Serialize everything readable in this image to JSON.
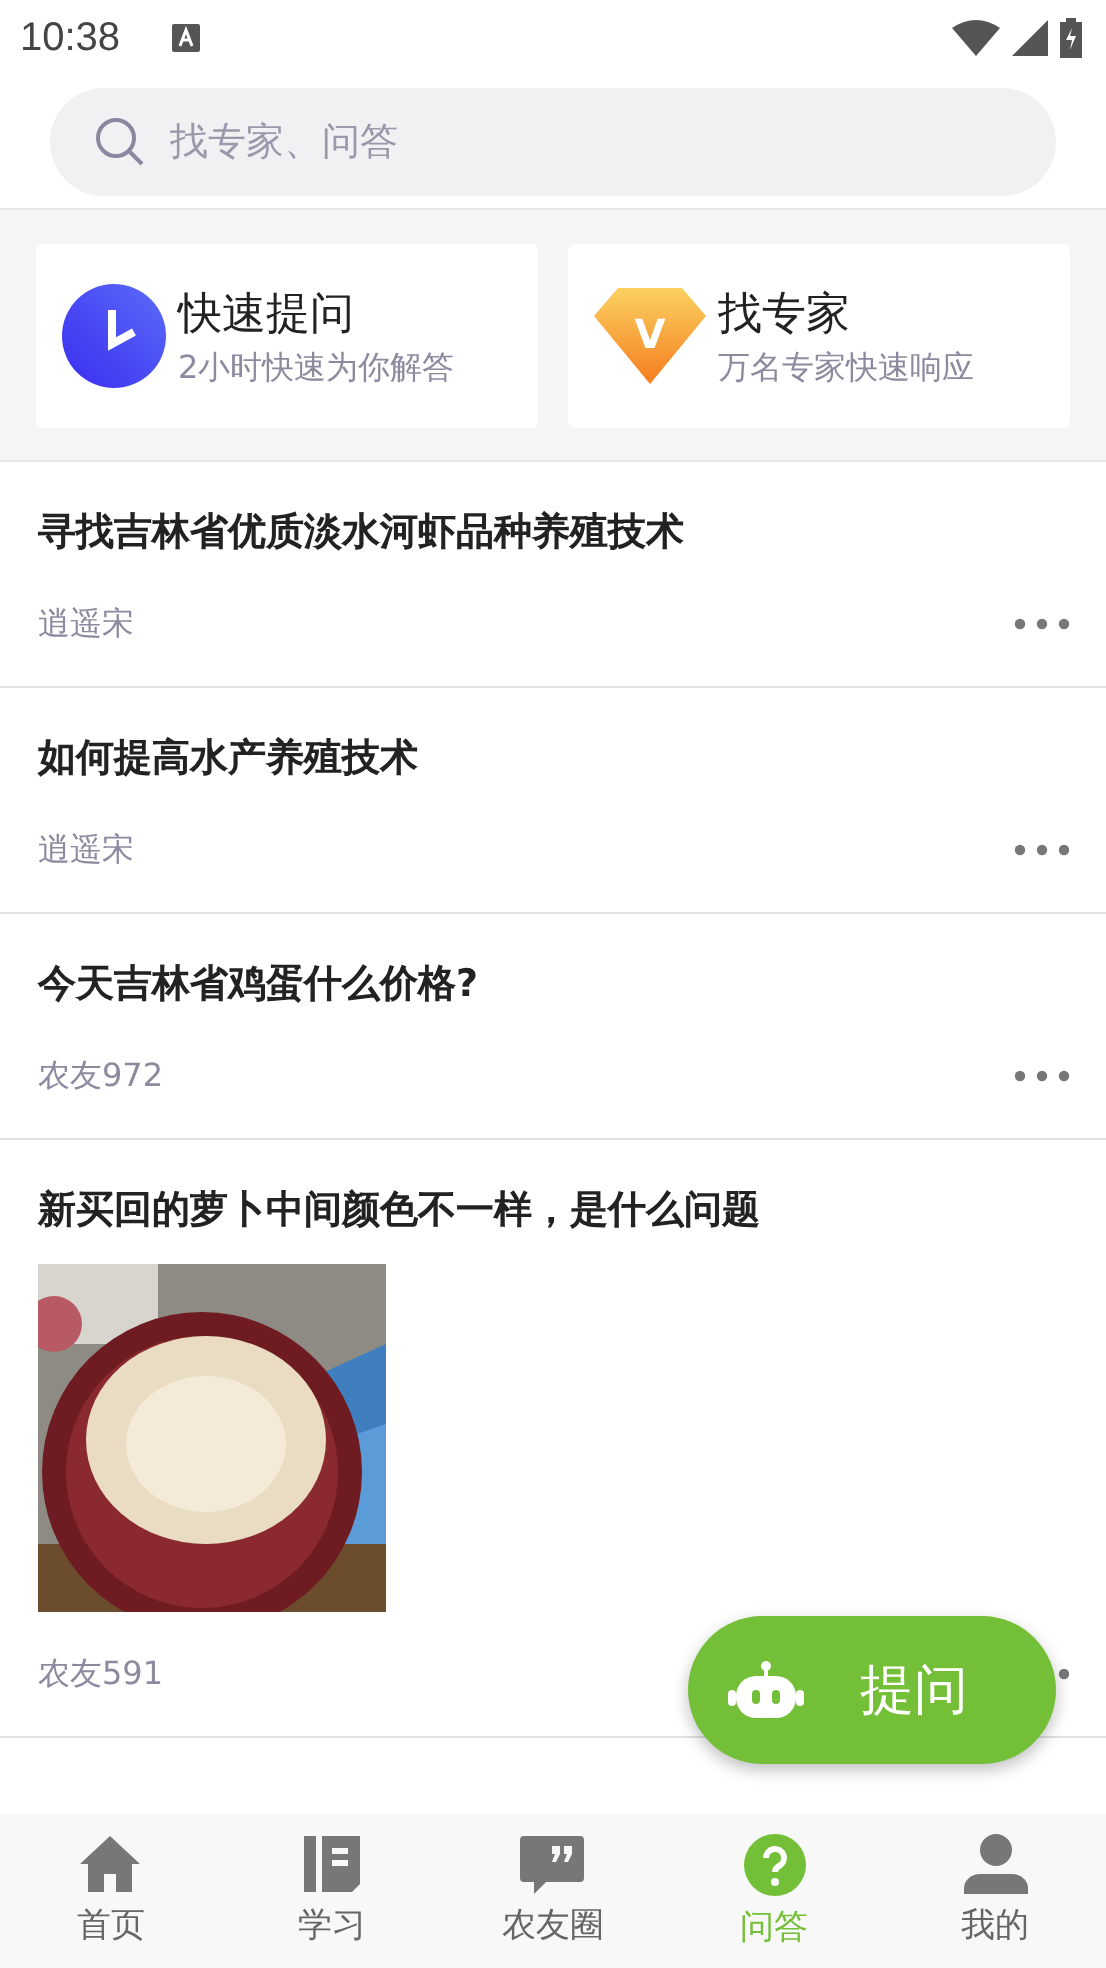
{
  "status_bar": {
    "time": "10:38"
  },
  "search": {
    "placeholder": "找专家、问答"
  },
  "shortcuts": [
    {
      "kind": "clock",
      "title": "快速提问",
      "subtitle": "2小时快速为你解答"
    },
    {
      "kind": "diamond",
      "title": "找专家",
      "subtitle": "万名专家快速响应",
      "badge": "V"
    }
  ],
  "posts": [
    {
      "title": "寻找吉林省优质淡水河虾品种养殖技术",
      "author": "逍遥宋",
      "more_covered": false
    },
    {
      "title": "如何提高水产养殖技术",
      "author": "逍遥宋",
      "more_covered": false
    },
    {
      "title": "今天吉林省鸡蛋什么价格?",
      "author": "农友972",
      "more_covered": false
    },
    {
      "title": "新买回的萝卜中间颜色不一样，是什么问题",
      "author": "农友591",
      "more_covered": true
    }
  ],
  "fab": {
    "label": "提问"
  },
  "tabs": [
    {
      "kind": "home",
      "label": "首页",
      "selected": false
    },
    {
      "kind": "book",
      "label": "学习",
      "selected": false
    },
    {
      "kind": "chat",
      "label": "农友圈",
      "selected": false
    },
    {
      "kind": "question",
      "label": "问答",
      "selected": true
    },
    {
      "kind": "person",
      "label": "我的",
      "selected": false
    }
  ]
}
